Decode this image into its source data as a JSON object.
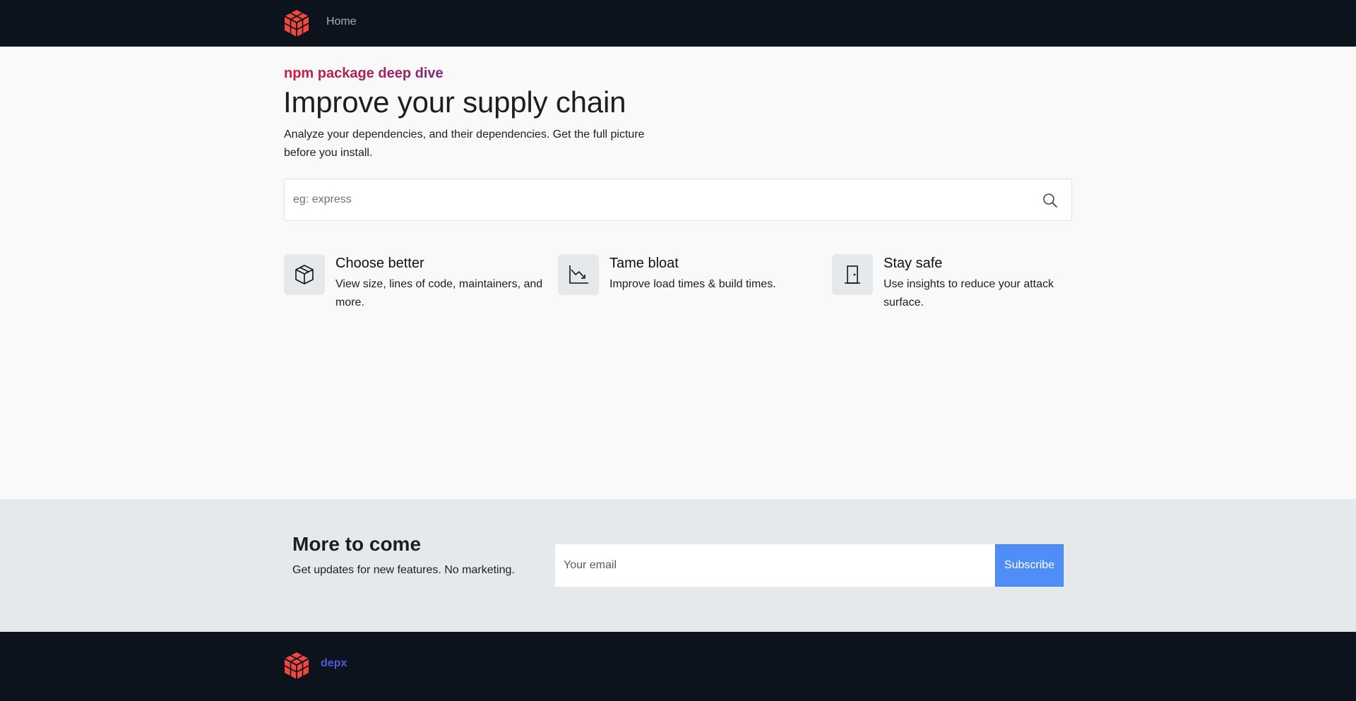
{
  "nav": {
    "logo_icon": "depx-cube-logo-icon",
    "home_label": "Home"
  },
  "hero": {
    "eyebrow": "npm package deep dive",
    "title": "Improve your supply chain",
    "subtitle": "Analyze your dependencies, and their dependencies. Get the full picture before you install."
  },
  "search": {
    "placeholder": "eg: express",
    "value": "",
    "icon": "search-icon"
  },
  "features": [
    {
      "icon": "box-icon",
      "title": "Choose better",
      "description": "View size, lines of code, maintainers, and more."
    },
    {
      "icon": "trending-down-chart-icon",
      "title": "Tame bloat",
      "description": "Improve load times & build times."
    },
    {
      "icon": "door-icon",
      "title": "Stay safe",
      "description": "Use insights to reduce your attack surface."
    }
  ],
  "newsletter": {
    "title": "More to come",
    "subtitle": "Get updates for new features. No marketing.",
    "email_placeholder": "Your email",
    "button_label": "Subscribe"
  },
  "footer": {
    "brand": "depx"
  },
  "colors": {
    "nav_bg": "#0d131c",
    "accent_red": "#d3193b",
    "accent_purple": "#7d2b7e",
    "subscribe_blue": "#4f8ef7",
    "brand_link": "#4f5bd5",
    "logo_red": "#f0483e"
  }
}
